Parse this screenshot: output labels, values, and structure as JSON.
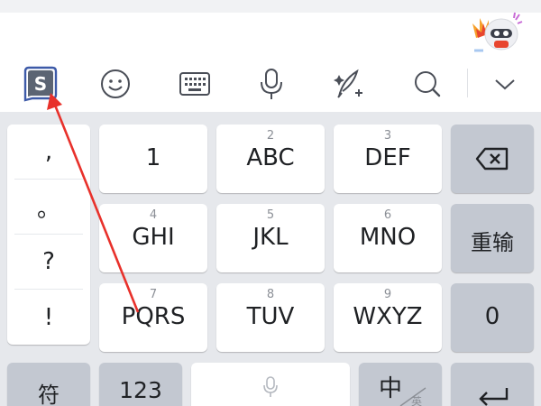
{
  "toolbar": {
    "icons": [
      "sogou-logo-icon",
      "emoji-icon",
      "keyboard-icon",
      "microphone-icon",
      "handwriting-icon",
      "search-icon",
      "chevron-down-icon"
    ]
  },
  "punctuation": [
    ",",
    "。",
    "?",
    "!"
  ],
  "keys": {
    "row1": [
      {
        "hint": "",
        "label": "1"
      },
      {
        "hint": "2",
        "label": "ABC"
      },
      {
        "hint": "3",
        "label": "DEF"
      }
    ],
    "row2": [
      {
        "hint": "4",
        "label": "GHI"
      },
      {
        "hint": "5",
        "label": "JKL"
      },
      {
        "hint": "6",
        "label": "MNO"
      }
    ],
    "row3": [
      {
        "hint": "7",
        "label": "PQRS"
      },
      {
        "hint": "8",
        "label": "TUV"
      },
      {
        "hint": "9",
        "label": "WXYZ"
      }
    ],
    "reinput": "重输",
    "zero": "0",
    "symbols": "符",
    "num123": "123",
    "lang_main": "中",
    "lang_sub": "英"
  },
  "colors": {
    "annotation_arrow": "#e8312b",
    "logo_blue": "#3d5aa8"
  }
}
